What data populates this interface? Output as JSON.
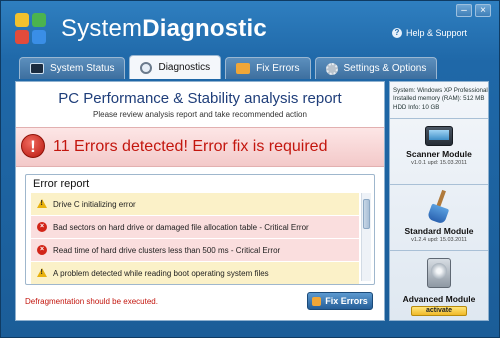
{
  "app": {
    "title_regular": "System",
    "title_bold": "Diagnostic",
    "help_label": "Help & Support"
  },
  "tabs": [
    {
      "label": "System Status",
      "icon": "monitor-icon"
    },
    {
      "label": "Diagnostics",
      "icon": "magnifier-icon",
      "active": true
    },
    {
      "label": "Fix Errors",
      "icon": "wrench-icon"
    },
    {
      "label": "Settings & Options",
      "icon": "gear-icon"
    }
  ],
  "report": {
    "title": "PC Performance & Stability analysis report",
    "subtitle": "Please review analysis report and take recommended action",
    "error_headline": "11 Errors detected! Error fix is required",
    "box_title": "Error report",
    "rows": [
      {
        "type": "warning",
        "text": "Drive C initializing error"
      },
      {
        "type": "error",
        "text": "Bad sectors on hard drive or damaged file allocation table - Critical Error"
      },
      {
        "type": "error",
        "text": "Read time of hard drive clusters less than 500 ms - Critical Error"
      },
      {
        "type": "warning",
        "text": "A problem detected while reading boot operating system files"
      }
    ],
    "defrag_note": "Defragmentation should be executed.",
    "fix_button": "Fix Errors"
  },
  "side": {
    "system_line": "System: Windows XP Professional",
    "ram_line": "Installed memory (RAM): 512 MB",
    "hdd_line": "HDD Info: 10 GB",
    "modules": [
      {
        "title": "Scanner Module",
        "version": "v1.0.1 upd: 15.03.2011"
      },
      {
        "title": "Standard Module",
        "version": "v1.2.4 upd: 15.03.2011"
      },
      {
        "title": "Advanced Module",
        "action": "activate"
      }
    ]
  },
  "colors": {
    "window_blue": "#1f68a8",
    "error_red": "#c3160e",
    "warning_yellow": "#fbf1c8",
    "error_row": "#fadede"
  }
}
